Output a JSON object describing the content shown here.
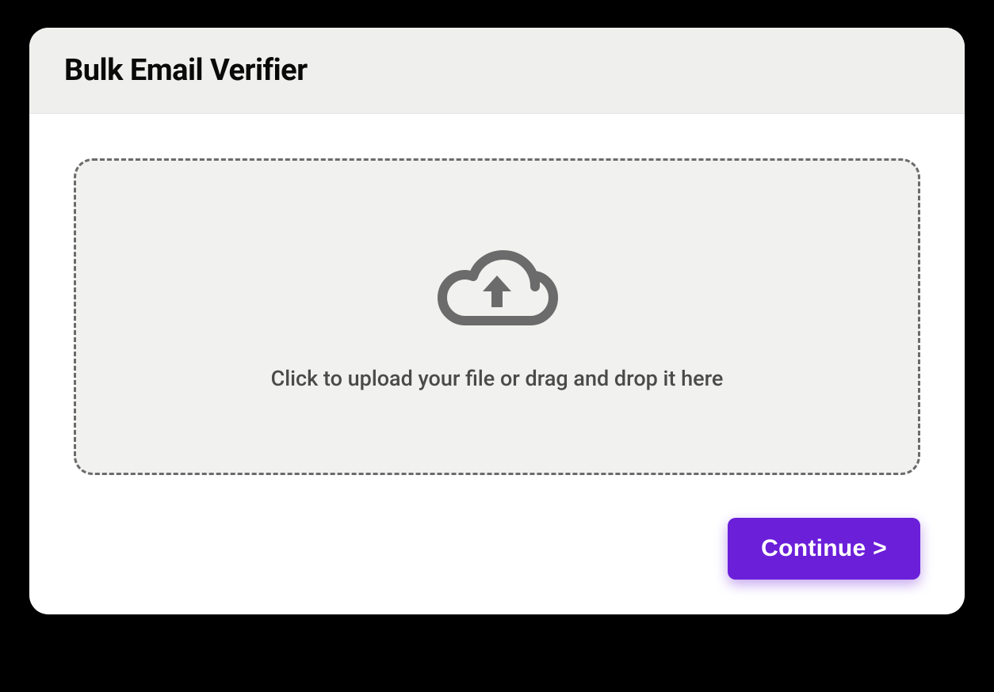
{
  "header": {
    "title": "Bulk Email Verifier"
  },
  "dropzone": {
    "instruction": "Click to upload your file or drag and drop it here"
  },
  "actions": {
    "continue_label": "Continue >"
  }
}
